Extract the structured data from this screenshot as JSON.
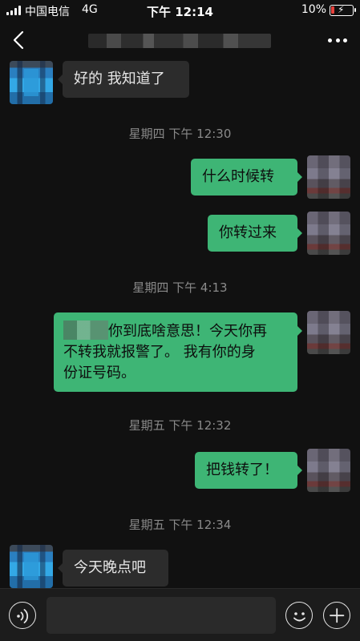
{
  "status_bar": {
    "carrier": "中国电信",
    "network": "4G",
    "time": "下午 12:14",
    "battery": "10%",
    "battery_level": 0.1
  },
  "nav": {
    "back_icon": "chevron-left-icon",
    "more_icon": "ellipsis-icon"
  },
  "messages": [
    {
      "type": "incoming",
      "text": "好的 我知道了"
    },
    {
      "type": "timestamp",
      "text": "星期四 下午 12:30"
    },
    {
      "type": "outgoing",
      "text": "什么时候转"
    },
    {
      "type": "outgoing",
      "text": "你转过来"
    },
    {
      "type": "timestamp",
      "text": "星期四 下午 4:13"
    },
    {
      "type": "outgoing",
      "text_line1": "你到底啥意思！今天你再",
      "text_line2": "不转我就报警了。 我有你的身",
      "text_line3": "份证号码。"
    },
    {
      "type": "timestamp",
      "text": "星期五 下午 12:32"
    },
    {
      "type": "outgoing",
      "text": "把钱转了！"
    },
    {
      "type": "timestamp",
      "text": "星期五 下午 12:34"
    },
    {
      "type": "incoming",
      "text": "今天晚点吧"
    }
  ],
  "input_bar": {
    "voice_icon": "voice-icon",
    "emoji_icon": "emoji-icon",
    "plus_icon": "plus-icon",
    "placeholder": ""
  },
  "colors": {
    "background": "#111111",
    "outgoing_bubble": "#3eb575",
    "incoming_bubble": "#2c2c2c",
    "timestamp": "#8a8a8a"
  }
}
